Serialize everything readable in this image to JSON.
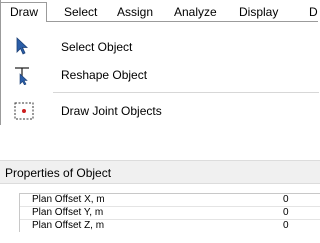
{
  "menubar": {
    "items": [
      {
        "label": "Draw",
        "active": true
      },
      {
        "label": "Select"
      },
      {
        "label": "Assign"
      },
      {
        "label": "Analyze"
      },
      {
        "label": "Display"
      },
      {
        "label": "D"
      }
    ]
  },
  "draw_menu": {
    "items": [
      {
        "label": "Select Object",
        "icon": "pointer-arrow-icon"
      },
      {
        "label": "Reshape Object",
        "icon": "reshape-pointer-icon"
      },
      {
        "label": "Draw Joint Objects",
        "icon": "joint-object-icon"
      }
    ]
  },
  "properties": {
    "title": "Properties of Object",
    "rows": [
      {
        "name": "Plan Offset X, m",
        "value": "0"
      },
      {
        "name": "Plan Offset Y, m",
        "value": "0"
      },
      {
        "name": "Plan Offset Z, m",
        "value": "0"
      }
    ]
  },
  "colors": {
    "border": "#9b9b9b",
    "header_bg": "#f0f0f0",
    "icon_blue": "#2b5ea8",
    "joint_red": "#cc1e1e"
  }
}
